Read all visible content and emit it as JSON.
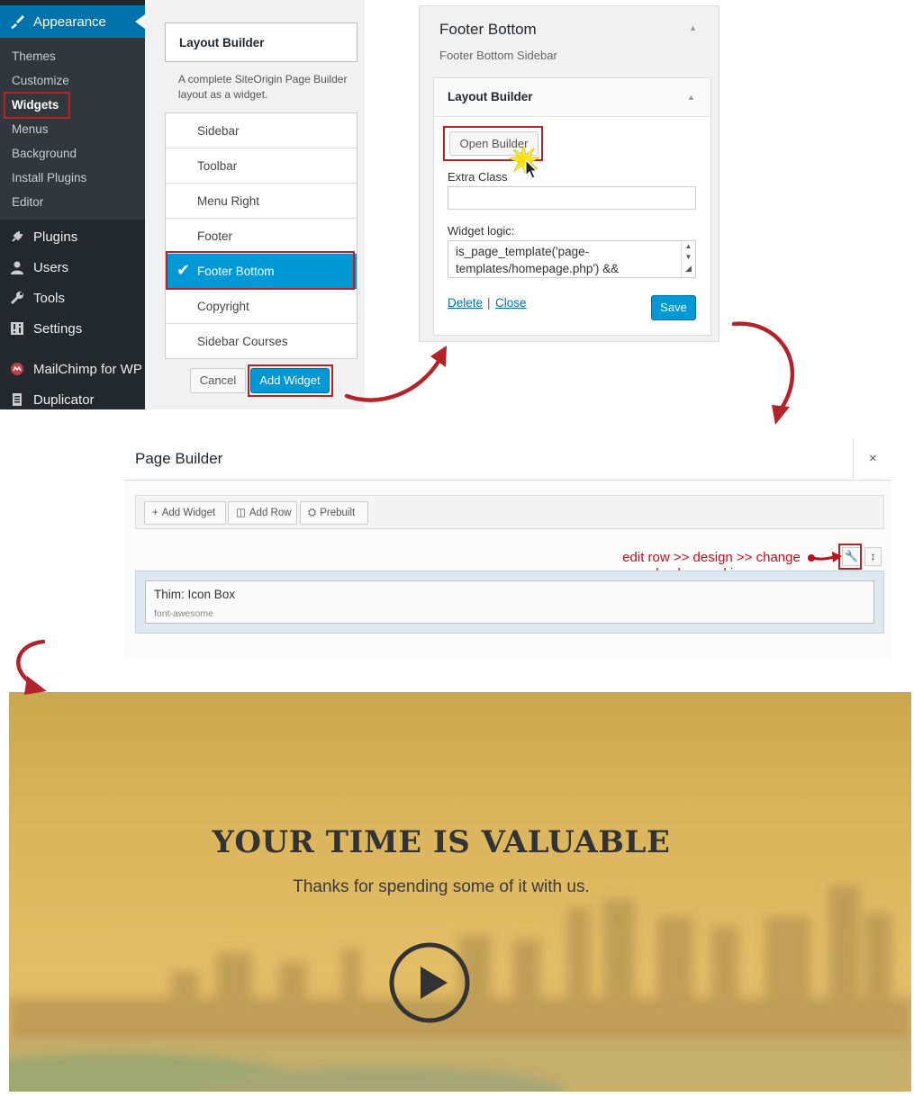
{
  "admin_menu": {
    "appearance": "Appearance",
    "submenu": [
      "Themes",
      "Customize",
      "Widgets",
      "Menus",
      "Background",
      "Install Plugins",
      "Editor"
    ],
    "main": [
      {
        "label": "Plugins",
        "icon": "plug-icon"
      },
      {
        "label": "Users",
        "icon": "users-icon"
      },
      {
        "label": "Tools",
        "icon": "wrench-icon"
      },
      {
        "label": "Settings",
        "icon": "settings-icon"
      },
      {
        "label": "MailChimp for WP",
        "icon": "mailchimp-icon"
      },
      {
        "label": "Duplicator",
        "icon": "duplicator-icon"
      }
    ]
  },
  "widget_chooser": {
    "title": "Layout Builder",
    "description": "A complete SiteOrigin Page Builder layout as a widget.",
    "sidebars": [
      "Sidebar",
      "Toolbar",
      "Menu Right",
      "Footer",
      "Footer Bottom",
      "Copyright",
      "Sidebar Courses"
    ],
    "selected": "Footer Bottom",
    "cancel_label": "Cancel",
    "add_label": "Add Widget"
  },
  "footer_bottom": {
    "title": "Footer Bottom",
    "subtitle": "Footer Bottom Sidebar",
    "widget_title": "Layout Builder",
    "open_builder_label": "Open Builder",
    "extra_class_label": "Extra Class",
    "extra_class_value": "",
    "widget_logic_label": "Widget logic:",
    "widget_logic_value": "is_page_template('page-templates/homepage.php') &&",
    "delete_label": "Delete",
    "separator": "|",
    "close_label": "Close",
    "save_label": "Save"
  },
  "page_builder": {
    "title": "Page Builder",
    "close_glyph": "×",
    "toolbar": [
      {
        "label": "Add Widget",
        "icon": "plus-icon",
        "glyph": "+"
      },
      {
        "label": "Add Row",
        "icon": "columns-icon",
        "glyph": "◫"
      },
      {
        "label": "Prebuilt",
        "icon": "cubes-icon",
        "glyph": "⛭"
      }
    ],
    "annotation": "edit row >> design >> change\nbackground image",
    "row_widget": {
      "title": "Thim: Icon Box",
      "desc": "font-awesome"
    }
  },
  "banner": {
    "title": "YOUR TIME IS VALUABLE",
    "subtitle": "Thanks for spending some of it with us."
  },
  "colors": {
    "wp_blue": "#0073aa",
    "button_blue": "#0099d6",
    "highlight_red": "#b2232a",
    "banner_gold": "#e2b85a"
  }
}
